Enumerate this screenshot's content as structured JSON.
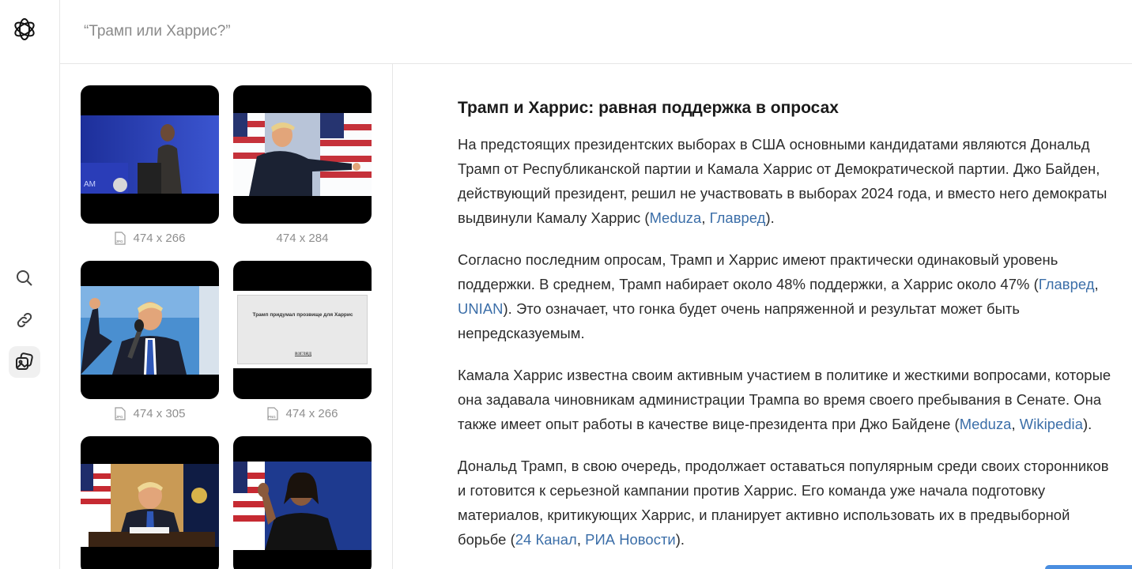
{
  "search": {
    "query": "“Трамп или Харрис?”"
  },
  "rail": {
    "logo_icon": "openai-logo-icon",
    "items": [
      {
        "icon": "search-icon",
        "active": false
      },
      {
        "icon": "link-icon",
        "active": false
      },
      {
        "icon": "images-icon",
        "active": true
      }
    ]
  },
  "images": [
    {
      "caption": "474 x 266",
      "file_type": "JPG",
      "subject": "harris-podium"
    },
    {
      "caption": "474 x 284",
      "file_type": "",
      "subject": "trump-pointing"
    },
    {
      "caption": "474 x 305",
      "file_type": "JPG",
      "subject": "trump-microphone"
    },
    {
      "caption": "474 x 266",
      "file_type": "PNG",
      "subject": "text-document",
      "doc_text": "Трамп придумал прозвище для Харрис",
      "doc_footer": "ВЗГЛЯД"
    },
    {
      "caption": "",
      "file_type": "",
      "subject": "trump-desk"
    },
    {
      "caption": "",
      "file_type": "",
      "subject": "harris-waving"
    }
  ],
  "article": {
    "title": "Трамп и Харрис: равная поддержка в опросах",
    "paragraphs": [
      {
        "text": "На предстоящих президентских выборах в США основными кандидатами являются Дональд Трамп от Республиканской партии и Камала Харрис от Демократической партии. Джо Байден, действующий президент, решил не участвовать в выборах 2024 года, и вместо него демократы выдвинули Камалу Харрис",
        "sources": [
          "Meduza",
          "Главред"
        ],
        "tail": ""
      },
      {
        "text": "Согласно последним опросам, Трамп и Харрис имеют практически одинаковый уровень поддержки. В среднем, Трамп набирает около 48% поддержки, а Харрис около 47%",
        "sources": [
          "Главред",
          "UNIAN"
        ],
        "tail": " Это означает, что гонка будет очень напряженной и результат может быть непредсказуемым."
      },
      {
        "text": "Камала Харрис известна своим активным участием в политике и жесткими вопросами, которые она задавала чиновникам администрации Трампа во время своего пребывания в Сенате. Она также имеет опыт работы в качестве вице-президента при Джо Байдене",
        "sources": [
          "Meduza",
          "Wikipedia"
        ],
        "tail": ""
      },
      {
        "text": "Дональд Трамп, в свою очередь, продолжает оставаться популярным среди своих сторонников и готовится к серьезной кампании против Харрис. Его команда уже начала подготовку материалов, критикующих Харрис, и планирует активно использовать их в предвыборной борьбе",
        "sources": [
          "24 Канал",
          "РИА Новости"
        ],
        "tail": ""
      }
    ]
  }
}
